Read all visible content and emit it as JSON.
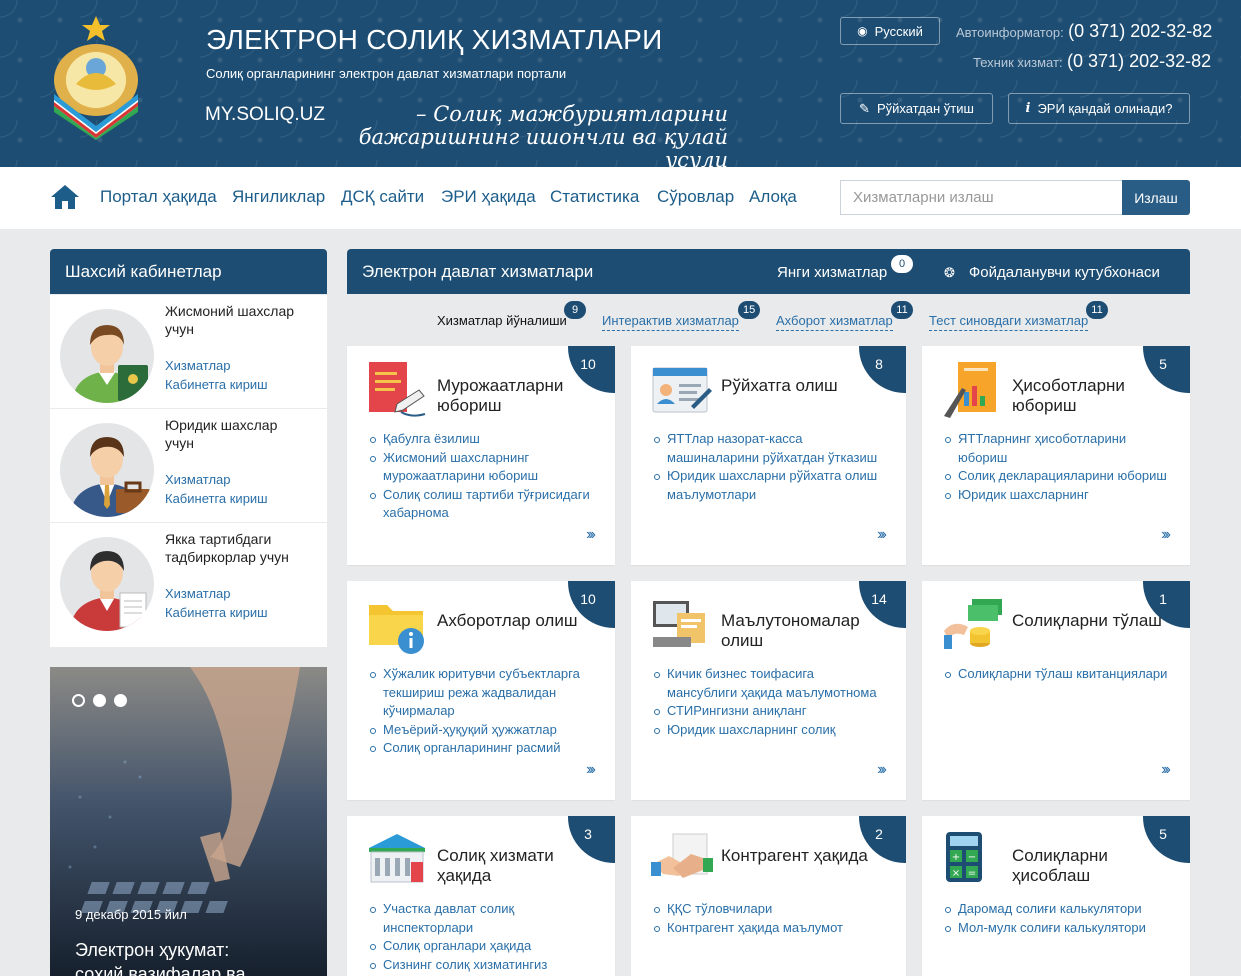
{
  "header": {
    "title": "ЭЛЕКТРОН СОЛИҚ ХИЗМАТЛАРИ",
    "subtitle": "Солиқ органларининг электрон давлат хизматлари портали",
    "site": "MY.SOLIQ.UZ",
    "slogan": "– Солиқ мажбуриятларини бажаришнинг ишончли ва қулай усули",
    "lang_button": "Русский",
    "autoinf_label": "Автоинформатор:",
    "autoinf_phone": "(0 371) 202-32-82",
    "tech_label": "Техник хизмат:",
    "tech_phone": "(0 371) 202-32-82",
    "register_button": "Рўйхатдан ўтиш",
    "eri_button": "ЭРИ қандай олинади?"
  },
  "nav": {
    "items": [
      "Портал ҳақида",
      "Янгиликлар",
      "ДСҚ сайти",
      "ЭРИ ҳақида",
      "Статистика",
      "Сўровлар",
      "Алоқа"
    ],
    "search_placeholder": "Хизматларни излаш",
    "search_button": "Излаш"
  },
  "cabinets": {
    "title": "Шахсий кабинетлар",
    "items": [
      {
        "name": "Жисмоний шахслар учун",
        "link1": "Хизматлар",
        "link2": "Кабинетга кириш"
      },
      {
        "name": "Юридик шахслар учун",
        "link1": "Хизматлар",
        "link2": "Кабинетга кириш"
      },
      {
        "name": "Якка тартибдаги тадбиркорлар учун",
        "link1": "Хизматлар",
        "link2": "Кабинетга кириш"
      }
    ]
  },
  "news": {
    "date": "9 декабр 2015 йил",
    "headline": "Электрон ҳукумат:",
    "headline2": "соҳий вазифалар ва"
  },
  "services": {
    "title": "Электрон давлат хизматлари",
    "new_label": "Янги хизматлар",
    "new_count": "0",
    "library_label": "Фойдаланувчи кутубхонаси",
    "tabs": [
      {
        "label": "Хизматлар йўналиши",
        "count": "9"
      },
      {
        "label": "Интерактив хизматлар",
        "count": "15"
      },
      {
        "label": "Ахборот хизматлар",
        "count": "11"
      },
      {
        "label": "Тест синовдаги хизматлар",
        "count": "11"
      }
    ],
    "more": "›››",
    "cards": [
      {
        "title": "Мурожаатларни юбориш",
        "count": "10",
        "icon": "document-pen-icon",
        "items": [
          "Қабулга ёзилиш",
          "Жисмоний шахсларнинг мурожаатларини юбориш",
          "Солиқ солиш тартиби тўғрисидаги хабарнома"
        ]
      },
      {
        "title": "Рўйхатга олиш",
        "count": "8",
        "icon": "id-card-icon",
        "items": [
          "ЯТТлар назорат-касса машиналарини рўйхатдан ўтказиш",
          "Юридик шахсларни рўйхатга олиш маълумотлари"
        ]
      },
      {
        "title": "Ҳисоботларни юбориш",
        "count": "5",
        "icon": "report-chart-icon",
        "items": [
          "ЯТТларнинг ҳисоботларини юбориш",
          "Солиқ декларацияларини юбориш",
          "Юридик шахсларнинг"
        ]
      },
      {
        "title": "Ахборотлар олиш",
        "count": "10",
        "icon": "folder-info-icon",
        "items": [
          "Хўжалик юритувчи субъектларга текшириш режа жадвалидан кўчирмалар",
          "Меъёрий-ҳуқуқий ҳужжатлар",
          "Солиқ органларининг расмий"
        ]
      },
      {
        "title": "Маълутономалар олиш",
        "count": "14",
        "icon": "computer-icon",
        "items": [
          "Кичик бизнес тоифасига мансублиги ҳақида маълумотнома",
          "СТИРингизни аниқланг",
          "Юридик шахсларнинг солиқ"
        ]
      },
      {
        "title": "Солиқларни тўлаш",
        "count": "1",
        "icon": "money-coins-icon",
        "items": [
          "Солиқларни тўлаш квитанциялари"
        ]
      },
      {
        "title": "Солиқ хизмати ҳақида",
        "count": "3",
        "icon": "building-icon",
        "items": [
          "Участка давлат солиқ инспекторлари",
          "Солиқ органлари ҳақида",
          "Сизнинг солиқ хизматингиз"
        ]
      },
      {
        "title": "Контрагент ҳақида",
        "count": "2",
        "icon": "handshake-icon",
        "items": [
          "ҚҚС тўловчилари",
          "Контрагент ҳақида маълумот"
        ]
      },
      {
        "title": "Солиқларни ҳисоблаш",
        "count": "5",
        "icon": "calculator-icon",
        "items": [
          "Даромад солиғи калькулятори",
          "Мол-мулк солиғи калькулятори"
        ]
      }
    ]
  }
}
